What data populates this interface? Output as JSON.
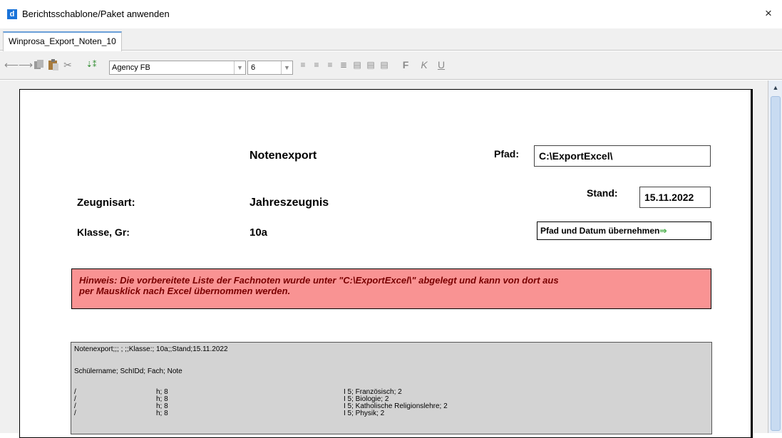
{
  "window": {
    "app_icon": "d",
    "title": "Berichtsschablone/Paket anwenden",
    "close": "×"
  },
  "tabs": [
    {
      "label": "Winprosa_Export_Noten_10"
    }
  ],
  "toolbar": {
    "icons": [
      "arrow-left-icon",
      "arrow-right-icon",
      "copy-icon",
      "paste-icon",
      "cut-icon",
      "insert-field-icon"
    ],
    "font_name": "Agency FB",
    "font_size": "6",
    "format_buttons": [
      "align-left-icon",
      "align-center-icon",
      "align-right-icon",
      "align-justify-icon",
      "align-top-icon",
      "align-middle-icon",
      "align-bottom-icon"
    ],
    "bold": "F",
    "italic": "K",
    "underline": "U"
  },
  "form": {
    "heading": "Notenexport",
    "pfad_label": "Pfad:",
    "pfad_value": "C:\\ExportExcel\\",
    "zeugnisart_label": "Zeugnisart:",
    "zeugnisart_value": "Jahreszeugnis",
    "stand_label": "Stand:",
    "stand_value": "15.11.2022",
    "klasse_label": "Klasse, Gr:",
    "klasse_value": "10a",
    "apply_button": "Pfad und Datum übernehmen",
    "apply_arrow": "⇒"
  },
  "hint": {
    "line1": "Hinweis: Die vorbereitete Liste der Fachnoten wurde unter \"C:\\ExportExcel\\\" abgelegt und kann von dort aus",
    "line2": "per Mausklick nach Excel übernommen werden."
  },
  "export": {
    "header": "Notenexport;;; ; ;;Klasse:; 10a;;Stand;15.11.2022",
    "columns": "Schülername; SchIDd; Fach; Note",
    "rows": [
      {
        "a": "/",
        "b": "h; 8",
        "c": "I 5; Französisch; 2"
      },
      {
        "a": "/",
        "b": "h; 8",
        "c": "I 5; Biologie; 2"
      },
      {
        "a": "/",
        "b": "h; 8",
        "c": "I 5; Katholische Religionslehre; 2"
      },
      {
        "a": "/",
        "b": "h; 8",
        "c": "I 5; Physik; 2"
      }
    ]
  },
  "colors": {
    "hint_bg": "#f99393",
    "hint_text": "#7a0000",
    "export_bg": "#d3d3d3",
    "tab_accent": "#6a9fd8"
  }
}
